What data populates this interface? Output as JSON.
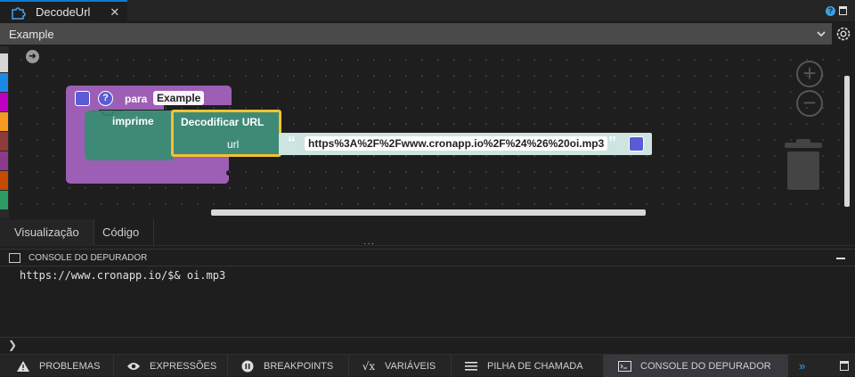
{
  "tab": {
    "title": "DecodeUrl",
    "close": "✕"
  },
  "selector": {
    "value": "Example"
  },
  "workspace": {
    "zoom_in": "+",
    "zoom_out": "−",
    "blocks": {
      "function_keyword": "para",
      "function_name": "Example",
      "print_label": "imprime",
      "decode_label": "Decodificar URL",
      "url_param": "url",
      "string_value": "https%3A%2F%2Fwww.cronapp.io%2F%24%26%20oi.mp3",
      "quote_open": "“",
      "quote_close": "”",
      "colors": {
        "function": "#9c5fb5",
        "print": "#3f8a76",
        "decode": "#3f8a76",
        "highlight": "#f2c230",
        "string": "#cde4e0"
      }
    }
  },
  "toolbox": {
    "colors": [
      "#d7d7d7",
      "#1e88e5",
      "#c000c0",
      "#a100c8",
      "#f59a22",
      "#8e3b3b",
      "#8c3a8c",
      "#c44b00",
      "#2e9a63"
    ]
  },
  "view_tabs": {
    "visualization": "Visualização",
    "code": "Código",
    "grip": "···"
  },
  "console": {
    "title": "CONSOLE DO DEPURADOR",
    "output": "https://www.cronapp.io/$& oi.mp3",
    "prompt_icon": "❯"
  },
  "statusbar": {
    "problems": "PROBLEMAS",
    "expressions": "EXPRESSÕES",
    "breakpoints": "BREAKPOINTS",
    "variables": "VARIÁVEIS",
    "callstack": "PILHA DE CHAMADA",
    "console": "CONSOLE DO DEPURADOR",
    "more": "»"
  }
}
